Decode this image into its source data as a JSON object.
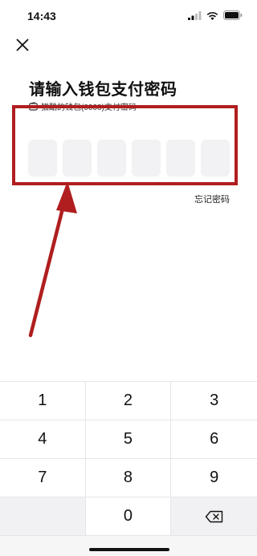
{
  "status_bar": {
    "time": "14:43",
    "icons": [
      "cellular-signal-icon",
      "wifi-icon",
      "battery-icon"
    ]
  },
  "header": {
    "close_icon": "close-icon",
    "title": "请输入钱包支付密码"
  },
  "wallet": {
    "icon": "wallet-icon",
    "text": "猫酷的钱包(0000)支付密码"
  },
  "pin": {
    "length": 6,
    "entered": 0
  },
  "forgot_password": "忘记密码",
  "annotation": {
    "color": "#b01e1f"
  },
  "keypad": {
    "keys": [
      "1",
      "2",
      "3",
      "4",
      "5",
      "6",
      "7",
      "8",
      "9",
      "",
      "0",
      ""
    ],
    "delete_icon": "backspace-icon"
  }
}
